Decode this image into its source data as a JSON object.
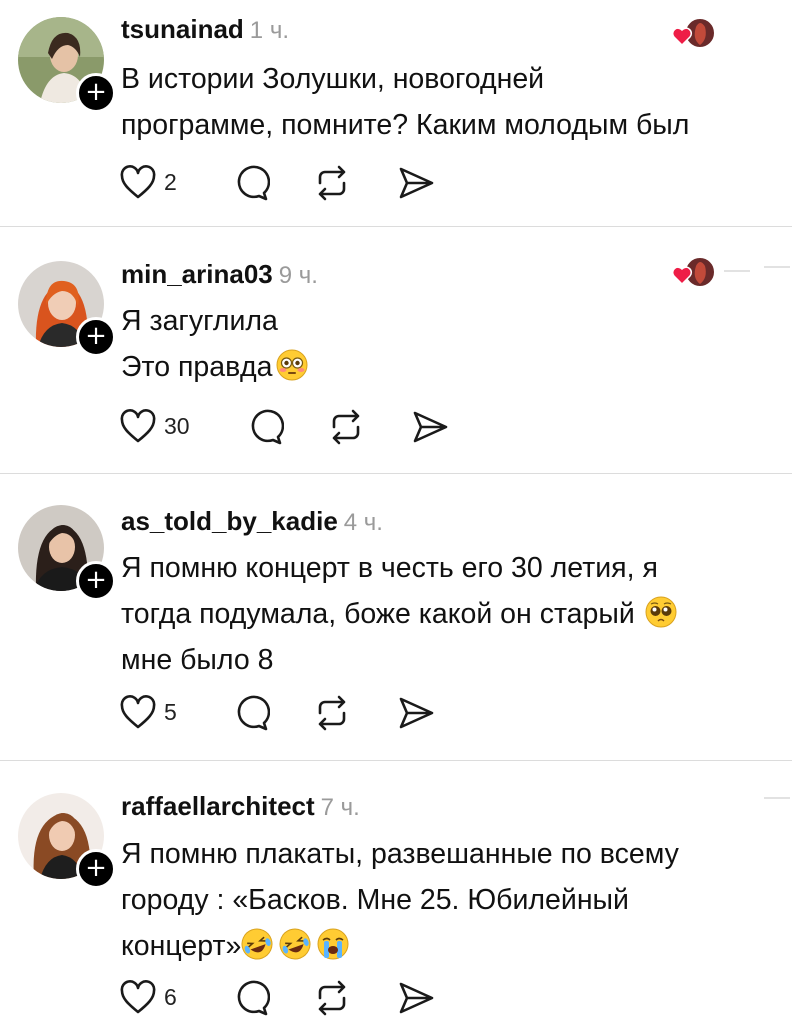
{
  "comments": [
    {
      "username": "tsunainad",
      "time": "1 ч.",
      "lines": [
        "В истории Золушки, новогодней",
        "программе, помните? Каким молодым был"
      ],
      "emojis": [
        [],
        []
      ],
      "likes": "2",
      "liked_by_author": true
    },
    {
      "username": "min_arina03",
      "time": "9 ч.",
      "lines": [
        "Я загуглила",
        "Это правда"
      ],
      "emojis": [
        [],
        [
          "flushed-face"
        ]
      ],
      "likes": "30",
      "liked_by_author": true
    },
    {
      "username": "as_told_by_kadie",
      "time": "4 ч.",
      "lines": [
        "Я помню концерт в честь его 30 летия, я",
        "тогда подумала, боже какой он старый",
        "мне было 8"
      ],
      "emojis": [
        [],
        [
          "pleading-face"
        ],
        []
      ],
      "likes": "5",
      "liked_by_author": false
    },
    {
      "username": "raffaellarchitect",
      "time": "7 ч.",
      "lines": [
        "Я помню плакаты, развешанные по всему",
        "городу : «Басков. Мне 25. Юбилейный",
        "концерт»"
      ],
      "emojis": [
        [],
        [],
        [
          "rolling-on-floor-laughing",
          "rolling-on-floor-laughing",
          "loudly-crying-face"
        ]
      ],
      "likes": "6",
      "liked_by_author": false
    }
  ],
  "icons": {
    "like": "heart-outline-icon",
    "reply": "speech-bubble-icon",
    "repost": "repost-icon",
    "share": "send-icon",
    "follow": "plus-icon",
    "follow_symbol": "+",
    "liked_heart": "red-heart-icon"
  },
  "colors": {
    "text": "#111111",
    "meta": "#9a9a9a",
    "divider": "#dcdcdc",
    "heart_red": "#ee1d46",
    "badge": "#000000"
  }
}
